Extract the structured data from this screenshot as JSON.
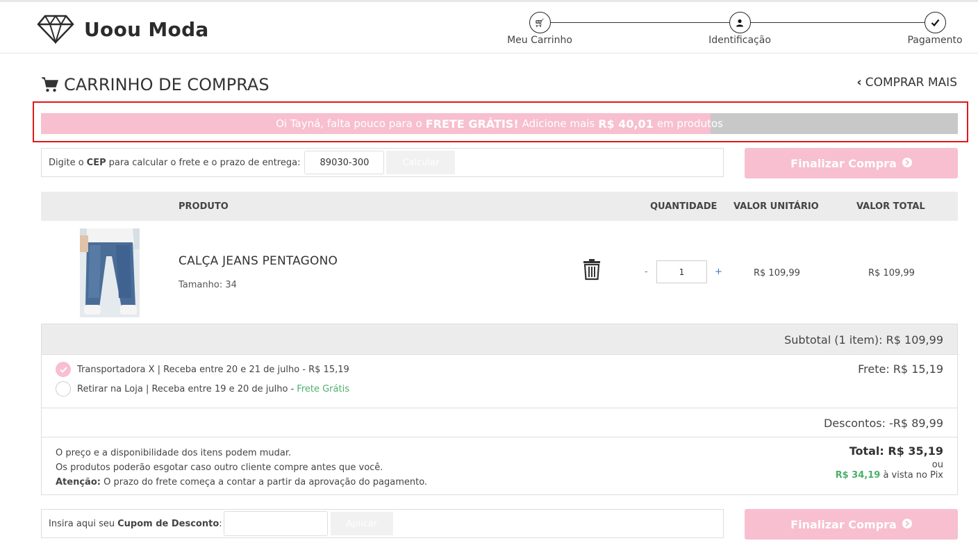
{
  "header": {
    "brand": "Uoou Moda",
    "steps": [
      {
        "label": "Meu Carrinho",
        "icon": "cart-icon"
      },
      {
        "label": "Identificação",
        "icon": "user-icon"
      },
      {
        "label": "Pagamento",
        "icon": "check-icon"
      }
    ]
  },
  "page": {
    "title": "CARRINHO DE COMPRAS",
    "comprar_mais": "COMPRAR MAIS"
  },
  "free_shipping": {
    "text_before": "Oi Tayná, falta pouco para o",
    "bold1": "FRETE GRÁTIS!",
    "text_middle": "Adicione mais",
    "bold2": "R$ 40,01",
    "text_after": "em produtos",
    "progress_percent": 73,
    "fill_color": "#f7bfd0",
    "track_color": "#c8c8c8",
    "highlight_color": "#e01818"
  },
  "cep": {
    "label_before": "Digite o",
    "label_bold": "CEP",
    "label_after": "para calcular o frete e o prazo de entrega:",
    "value": "89030-300",
    "button": "Calcular"
  },
  "finalizar": {
    "label": "Finalizar Compra",
    "color": "#f7bfd0"
  },
  "table": {
    "headers": {
      "produto": "PRODUTO",
      "quantidade": "QUANTIDADE",
      "valor_unitario": "VALOR UNITÁRIO",
      "valor_total": "VALOR TOTAL"
    },
    "item": {
      "name": "CALÇA JEANS PENTAGONO",
      "size": "Tamanho: 34",
      "qty_minus": "-",
      "qty": "1",
      "qty_plus": "+",
      "unit_price": "R$ 109,99",
      "total_price": "R$ 109,99"
    }
  },
  "summary": {
    "subtotal": "Subtotal (1 item): R$ 109,99",
    "options": [
      {
        "label": "Transportadora X | Receba entre 20 e 21 de julho - R$ 15,19",
        "selected": true
      },
      {
        "label": "Retirar na Loja | Receba entre 19 e 20 de julho -",
        "extra": "Frete Grátis",
        "selected": false
      }
    ],
    "frete": "Frete: R$ 15,19",
    "descontos": "Descontos: -R$ 89,99",
    "notes": [
      "O preço e a disponibilidade dos itens podem mudar.",
      "Os produtos poderão esgotar caso outro cliente compre antes que você."
    ],
    "attention_label": "Atenção:",
    "attention_text": "O prazo do frete começa a contar a partir da aprovação do pagamento.",
    "total": "Total: R$ 35,19",
    "ou": "ou",
    "pix_value": "R$ 34,19",
    "pix_text": "à vista no Pix",
    "pix_color": "#4caf6c"
  },
  "coupon": {
    "label_before": "Insira aqui seu",
    "label_bold": "Cupom de Desconto",
    "label_after": ":",
    "button": "Aplicar"
  }
}
